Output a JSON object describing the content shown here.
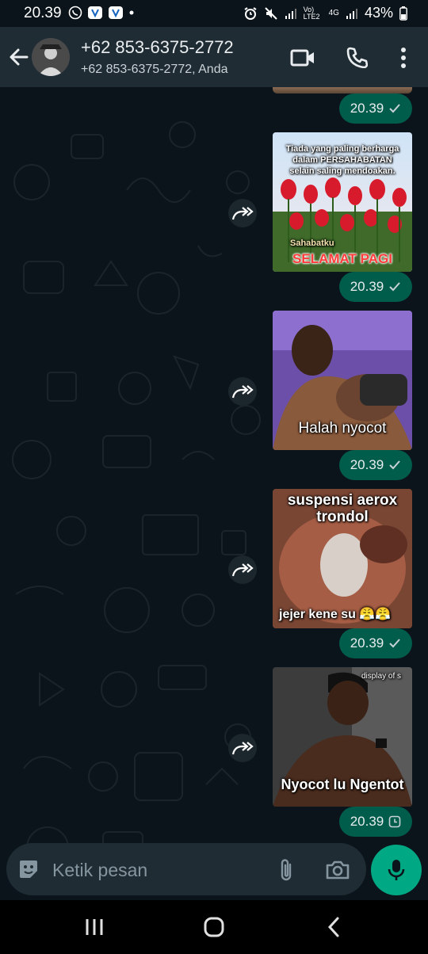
{
  "status_bar": {
    "time": "20.39",
    "network_label": "Vo) LTE2",
    "data_label": "4G",
    "battery": "43%"
  },
  "header": {
    "contact_name": "+62 853-6375-2772",
    "participants": "+62 853-6375-2772, Anda",
    "icons": [
      "back-arrow-icon",
      "video-call-icon",
      "voice-call-icon",
      "more-options-icon"
    ]
  },
  "messages": [
    {
      "time": "20.39",
      "status": "delivered"
    },
    {
      "time": "20.39",
      "status": "delivered",
      "captions": [
        "Tiada yang paling berharga",
        "dalam PERSAHABATAN",
        "selain saling mendoakan.",
        "Sahabatku",
        "SELAMAT PAGI"
      ]
    },
    {
      "time": "20.39",
      "status": "delivered",
      "captions": [
        "Halah nyocot"
      ]
    },
    {
      "time": "20.39",
      "status": "delivered",
      "captions": [
        "suspensi aerox",
        "trondol",
        "jejer kene su"
      ]
    },
    {
      "time": "20.39",
      "status": "pending",
      "captions": [
        "Nyocot lu Ngentot",
        "display of s"
      ]
    }
  ],
  "composer": {
    "placeholder": "Ketik pesan"
  },
  "colors": {
    "background": "#0b141a",
    "header": "#1f2c34",
    "bubble": "#005c4b",
    "accent": "#00a884"
  }
}
